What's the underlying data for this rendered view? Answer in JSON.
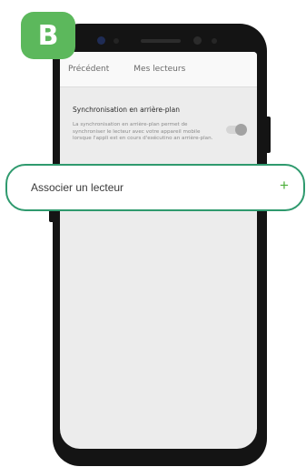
{
  "badge": {
    "letter": "B",
    "color": "#5cb85c"
  },
  "nav": {
    "back_label": "Précédent",
    "title": "Mes lecteurs"
  },
  "sync": {
    "title": "Synchronisation en arrière-plan",
    "description": "La synchronisation en arrière-plan permet de synchroniser le lecteur avec votre appareil mobile lorsque l'appli est en cours d'exécutino an arrière-plan.",
    "toggle_on": true
  },
  "callout": {
    "label": "Associer un lecteur",
    "plus_symbol": "+",
    "border_color": "#2f9a6e",
    "accent_color": "#4caf3a"
  },
  "icons": [
    "add-icon",
    "toggle-switch-icon"
  ]
}
